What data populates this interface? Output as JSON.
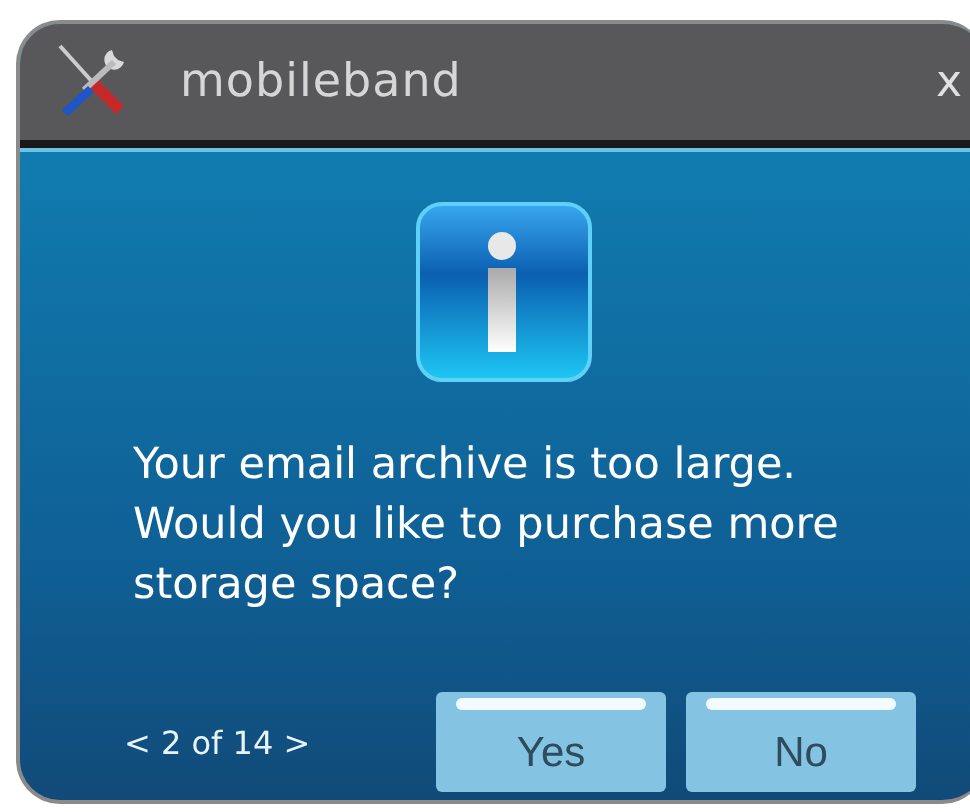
{
  "window": {
    "title": "mobileband",
    "close": "x"
  },
  "message": "Your email archive is too large. Would you like to purchase more storage space?",
  "pager": "< 2 of 14 >",
  "buttons": [
    "Yes",
    "No"
  ]
}
